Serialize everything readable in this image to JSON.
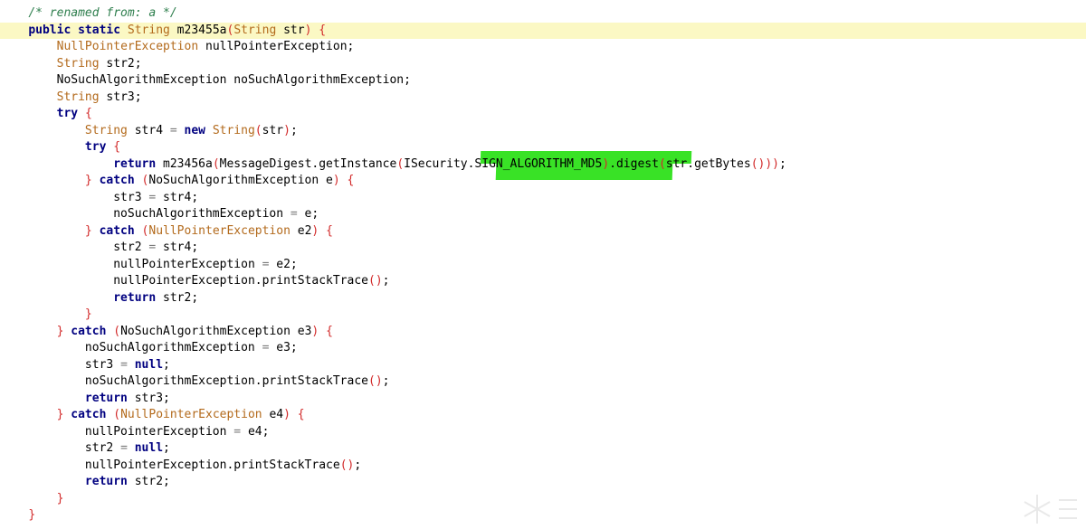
{
  "code": {
    "lines": [
      {
        "indent": 4,
        "current": false,
        "tokens": [
          [
            "cmt",
            "/* renamed from: a */"
          ]
        ]
      },
      {
        "indent": 4,
        "current": true,
        "tokens": [
          [
            "kw",
            "public static "
          ],
          [
            "type",
            "String"
          ],
          [
            "plain",
            " m23455a"
          ],
          [
            "br",
            "("
          ],
          [
            "type",
            "String"
          ],
          [
            "plain",
            " str"
          ],
          [
            "br",
            ")"
          ],
          [
            "plain",
            " "
          ],
          [
            "br",
            "{"
          ]
        ]
      },
      {
        "indent": 8,
        "current": false,
        "tokens": [
          [
            "type",
            "NullPointerException"
          ],
          [
            "plain",
            " nullPointerException;"
          ]
        ]
      },
      {
        "indent": 8,
        "current": false,
        "tokens": [
          [
            "type",
            "String"
          ],
          [
            "plain",
            " str2;"
          ]
        ]
      },
      {
        "indent": 8,
        "current": false,
        "tokens": [
          [
            "plain",
            "NoSuchAlgorithmException noSuchAlgorithmException;"
          ]
        ]
      },
      {
        "indent": 8,
        "current": false,
        "tokens": [
          [
            "type",
            "String"
          ],
          [
            "plain",
            " str3;"
          ]
        ]
      },
      {
        "indent": 8,
        "current": false,
        "tokens": [
          [
            "kw",
            "try"
          ],
          [
            "plain",
            " "
          ],
          [
            "br",
            "{"
          ]
        ]
      },
      {
        "indent": 12,
        "current": false,
        "tokens": [
          [
            "type",
            "String"
          ],
          [
            "plain",
            " str4 "
          ],
          [
            "op",
            "="
          ],
          [
            "plain",
            " "
          ],
          [
            "kw",
            "new"
          ],
          [
            "plain",
            " "
          ],
          [
            "type",
            "String"
          ],
          [
            "br",
            "("
          ],
          [
            "plain",
            "str"
          ],
          [
            "br",
            ")"
          ],
          [
            "plain",
            ";"
          ]
        ]
      },
      {
        "indent": 12,
        "current": false,
        "tokens": [
          [
            "kw",
            "try"
          ],
          [
            "plain",
            " "
          ],
          [
            "br",
            "{"
          ]
        ]
      },
      {
        "indent": 16,
        "current": false,
        "tokens": [
          [
            "kw",
            "return"
          ],
          [
            "plain",
            " m23456a"
          ],
          [
            "br",
            "("
          ],
          [
            "plain",
            "MessageDigest.getInstance"
          ],
          [
            "br",
            "("
          ],
          [
            "plain",
            "ISecurity.SIGN_ALGORITHM_MD5"
          ],
          [
            "br",
            ")"
          ],
          [
            "plain",
            ".digest"
          ],
          [
            "br",
            "("
          ],
          [
            "plain",
            "str.getBytes"
          ],
          [
            "br",
            "()))"
          ],
          [
            "plain",
            ";"
          ]
        ]
      },
      {
        "indent": 12,
        "current": false,
        "tokens": [
          [
            "br",
            "}"
          ],
          [
            "plain",
            " "
          ],
          [
            "kw",
            "catch"
          ],
          [
            "plain",
            " "
          ],
          [
            "br",
            "("
          ],
          [
            "plain",
            "NoSuchAlgorithmException e"
          ],
          [
            "br",
            ")"
          ],
          [
            "plain",
            " "
          ],
          [
            "br",
            "{"
          ]
        ]
      },
      {
        "indent": 16,
        "current": false,
        "tokens": [
          [
            "plain",
            "str3 "
          ],
          [
            "op",
            "="
          ],
          [
            "plain",
            " str4;"
          ]
        ]
      },
      {
        "indent": 16,
        "current": false,
        "tokens": [
          [
            "plain",
            "noSuchAlgorithmException "
          ],
          [
            "op",
            "="
          ],
          [
            "plain",
            " e;"
          ]
        ]
      },
      {
        "indent": 12,
        "current": false,
        "tokens": [
          [
            "br",
            "}"
          ],
          [
            "plain",
            " "
          ],
          [
            "kw",
            "catch"
          ],
          [
            "plain",
            " "
          ],
          [
            "br",
            "("
          ],
          [
            "type",
            "NullPointerException"
          ],
          [
            "plain",
            " e2"
          ],
          [
            "br",
            ")"
          ],
          [
            "plain",
            " "
          ],
          [
            "br",
            "{"
          ]
        ]
      },
      {
        "indent": 16,
        "current": false,
        "tokens": [
          [
            "plain",
            "str2 "
          ],
          [
            "op",
            "="
          ],
          [
            "plain",
            " str4;"
          ]
        ]
      },
      {
        "indent": 16,
        "current": false,
        "tokens": [
          [
            "plain",
            "nullPointerException "
          ],
          [
            "op",
            "="
          ],
          [
            "plain",
            " e2;"
          ]
        ]
      },
      {
        "indent": 16,
        "current": false,
        "tokens": [
          [
            "plain",
            "nullPointerException.printStackTrace"
          ],
          [
            "br",
            "()"
          ],
          [
            "plain",
            ";"
          ]
        ]
      },
      {
        "indent": 16,
        "current": false,
        "tokens": [
          [
            "kw",
            "return"
          ],
          [
            "plain",
            " str2;"
          ]
        ]
      },
      {
        "indent": 12,
        "current": false,
        "tokens": [
          [
            "br",
            "}"
          ]
        ]
      },
      {
        "indent": 8,
        "current": false,
        "tokens": [
          [
            "br",
            "}"
          ],
          [
            "plain",
            " "
          ],
          [
            "kw",
            "catch"
          ],
          [
            "plain",
            " "
          ],
          [
            "br",
            "("
          ],
          [
            "plain",
            "NoSuchAlgorithmException e3"
          ],
          [
            "br",
            ")"
          ],
          [
            "plain",
            " "
          ],
          [
            "br",
            "{"
          ]
        ]
      },
      {
        "indent": 12,
        "current": false,
        "tokens": [
          [
            "plain",
            "noSuchAlgorithmException "
          ],
          [
            "op",
            "="
          ],
          [
            "plain",
            " e3;"
          ]
        ]
      },
      {
        "indent": 12,
        "current": false,
        "tokens": [
          [
            "plain",
            "str3 "
          ],
          [
            "op",
            "="
          ],
          [
            "plain",
            " "
          ],
          [
            "kw",
            "null"
          ],
          [
            "plain",
            ";"
          ]
        ]
      },
      {
        "indent": 12,
        "current": false,
        "tokens": [
          [
            "plain",
            "noSuchAlgorithmException.printStackTrace"
          ],
          [
            "br",
            "()"
          ],
          [
            "plain",
            ";"
          ]
        ]
      },
      {
        "indent": 12,
        "current": false,
        "tokens": [
          [
            "kw",
            "return"
          ],
          [
            "plain",
            " str3;"
          ]
        ]
      },
      {
        "indent": 8,
        "current": false,
        "tokens": [
          [
            "br",
            "}"
          ],
          [
            "plain",
            " "
          ],
          [
            "kw",
            "catch"
          ],
          [
            "plain",
            " "
          ],
          [
            "br",
            "("
          ],
          [
            "type",
            "NullPointerException"
          ],
          [
            "plain",
            " e4"
          ],
          [
            "br",
            ")"
          ],
          [
            "plain",
            " "
          ],
          [
            "br",
            "{"
          ]
        ]
      },
      {
        "indent": 12,
        "current": false,
        "tokens": [
          [
            "plain",
            "nullPointerException "
          ],
          [
            "op",
            "="
          ],
          [
            "plain",
            " e4;"
          ]
        ]
      },
      {
        "indent": 12,
        "current": false,
        "tokens": [
          [
            "plain",
            "str2 "
          ],
          [
            "op",
            "="
          ],
          [
            "plain",
            " "
          ],
          [
            "kw",
            "null"
          ],
          [
            "plain",
            ";"
          ]
        ]
      },
      {
        "indent": 12,
        "current": false,
        "tokens": [
          [
            "plain",
            "nullPointerException.printStackTrace"
          ],
          [
            "br",
            "()"
          ],
          [
            "plain",
            ";"
          ]
        ]
      },
      {
        "indent": 12,
        "current": false,
        "tokens": [
          [
            "kw",
            "return"
          ],
          [
            "plain",
            " str2;"
          ]
        ]
      },
      {
        "indent": 8,
        "current": false,
        "tokens": [
          [
            "br",
            "}"
          ]
        ]
      },
      {
        "indent": 4,
        "current": false,
        "tokens": [
          [
            "br",
            "}"
          ]
        ]
      }
    ]
  },
  "highlight": {
    "color": "#2ee01a"
  },
  "watermark": {
    "icon": "snowflake-watermark-icon"
  }
}
